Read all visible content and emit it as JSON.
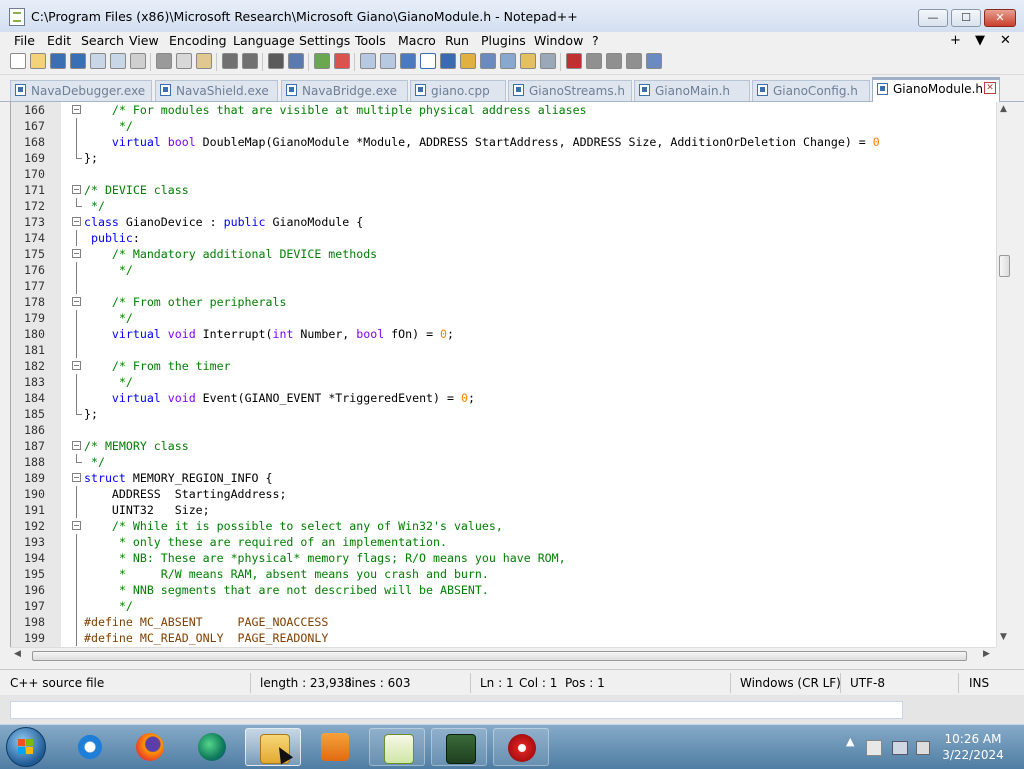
{
  "window": {
    "title": "C:\\Program Files (x86)\\Microsoft Research\\Microsoft Giano\\GianoModule.h - Notepad++",
    "minimize": "—",
    "maximize": "☐",
    "close": "✕"
  },
  "menu": {
    "items": [
      "File",
      "Edit",
      "Search",
      "View",
      "Encoding",
      "Language",
      "Settings",
      "Tools",
      "Macro",
      "Run",
      "Plugins",
      "Window",
      "?"
    ],
    "right": [
      "+",
      "▼",
      "✕"
    ]
  },
  "toolbar": {
    "buttons": [
      "new-file-icon",
      "open-file-icon",
      "save-icon",
      "save-all-icon",
      "close-icon",
      "close-all-icon",
      "print-icon",
      "cut-icon",
      "copy-icon",
      "paste-icon",
      "undo-icon",
      "redo-icon",
      "find-icon",
      "replace-icon",
      "zoom-in-icon",
      "zoom-out-icon",
      "sync-v-icon",
      "sync-h-icon",
      "word-wrap-icon",
      "show-all-chars-icon",
      "indent-guide-icon",
      "user-lang-icon",
      "doc-map-icon",
      "function-list-icon",
      "folder-workspace-icon",
      "monitor-icon",
      "record-macro-icon",
      "stop-macro-icon",
      "play-macro-icon",
      "run-macro-multiple-icon",
      "save-macro-icon"
    ]
  },
  "tabs": [
    {
      "label": "NavaDebugger.exe",
      "active": false
    },
    {
      "label": "NavaShield.exe",
      "active": false
    },
    {
      "label": "NavaBridge.exe",
      "active": false
    },
    {
      "label": "giano.cpp",
      "active": false
    },
    {
      "label": "GianoStreams.h",
      "active": false
    },
    {
      "label": "GianoMain.h",
      "active": false
    },
    {
      "label": "GianoConfig.h",
      "active": false
    },
    {
      "label": "GianoModule.h",
      "active": true
    }
  ],
  "editor": {
    "lines": [
      {
        "n": "166",
        "fold": "box",
        "parts": [
          [
            "comment",
            "    /* For modules that are visible at multiple physical address aliases"
          ]
        ]
      },
      {
        "n": "167",
        "fold": "line",
        "parts": [
          [
            "comment",
            "     */"
          ]
        ]
      },
      {
        "n": "168",
        "fold": "line",
        "parts": [
          [
            "plain",
            "    "
          ],
          [
            "kw",
            "virtual"
          ],
          [
            "plain",
            " "
          ],
          [
            "type",
            "bool"
          ],
          [
            "plain",
            " DoubleMap(GianoModule *Module, ADDRESS StartAddress, ADDRESS Size, AdditionOrDeletion Change) = "
          ],
          [
            "num",
            "0"
          ]
        ]
      },
      {
        "n": "169",
        "fold": "end",
        "parts": [
          [
            "plain",
            "};"
          ]
        ]
      },
      {
        "n": "170",
        "fold": "",
        "parts": [
          [
            "plain",
            ""
          ]
        ]
      },
      {
        "n": "171",
        "fold": "box",
        "parts": [
          [
            "comment",
            "/* DEVICE class"
          ]
        ]
      },
      {
        "n": "172",
        "fold": "end",
        "parts": [
          [
            "comment",
            " */"
          ]
        ]
      },
      {
        "n": "173",
        "fold": "box",
        "parts": [
          [
            "kw",
            "class"
          ],
          [
            "plain",
            " GianoDevice : "
          ],
          [
            "kw",
            "public"
          ],
          [
            "plain",
            " GianoModule {"
          ]
        ]
      },
      {
        "n": "174",
        "fold": "line",
        "parts": [
          [
            "kw",
            " public"
          ],
          [
            "plain",
            ":"
          ]
        ]
      },
      {
        "n": "175",
        "fold": "box",
        "parts": [
          [
            "comment",
            "    /* Mandatory additional DEVICE methods"
          ]
        ]
      },
      {
        "n": "176",
        "fold": "line",
        "parts": [
          [
            "comment",
            "     */"
          ]
        ]
      },
      {
        "n": "177",
        "fold": "line",
        "parts": [
          [
            "plain",
            ""
          ]
        ]
      },
      {
        "n": "178",
        "fold": "box",
        "parts": [
          [
            "comment",
            "    /* From other peripherals"
          ]
        ]
      },
      {
        "n": "179",
        "fold": "line",
        "parts": [
          [
            "comment",
            "     */"
          ]
        ]
      },
      {
        "n": "180",
        "fold": "line",
        "parts": [
          [
            "plain",
            "    "
          ],
          [
            "kw",
            "virtual"
          ],
          [
            "plain",
            " "
          ],
          [
            "type",
            "void"
          ],
          [
            "plain",
            " Interrupt("
          ],
          [
            "type",
            "int"
          ],
          [
            "plain",
            " Number, "
          ],
          [
            "type",
            "bool"
          ],
          [
            "plain",
            " fOn) = "
          ],
          [
            "num",
            "0"
          ],
          [
            "plain",
            ";"
          ]
        ]
      },
      {
        "n": "181",
        "fold": "line",
        "parts": [
          [
            "plain",
            ""
          ]
        ]
      },
      {
        "n": "182",
        "fold": "box",
        "parts": [
          [
            "comment",
            "    /* From the timer"
          ]
        ]
      },
      {
        "n": "183",
        "fold": "line",
        "parts": [
          [
            "comment",
            "     */"
          ]
        ]
      },
      {
        "n": "184",
        "fold": "line",
        "parts": [
          [
            "plain",
            "    "
          ],
          [
            "kw",
            "virtual"
          ],
          [
            "plain",
            " "
          ],
          [
            "type",
            "void"
          ],
          [
            "plain",
            " Event(GIANO_EVENT *TriggeredEvent) = "
          ],
          [
            "num",
            "0"
          ],
          [
            "plain",
            ";"
          ]
        ]
      },
      {
        "n": "185",
        "fold": "end",
        "parts": [
          [
            "plain",
            "};"
          ]
        ]
      },
      {
        "n": "186",
        "fold": "",
        "parts": [
          [
            "plain",
            ""
          ]
        ]
      },
      {
        "n": "187",
        "fold": "box",
        "parts": [
          [
            "comment",
            "/* MEMORY class"
          ]
        ]
      },
      {
        "n": "188",
        "fold": "end",
        "parts": [
          [
            "comment",
            " */"
          ]
        ]
      },
      {
        "n": "189",
        "fold": "box",
        "parts": [
          [
            "kw",
            "struct"
          ],
          [
            "plain",
            " MEMORY_REGION_INFO {"
          ]
        ]
      },
      {
        "n": "190",
        "fold": "line",
        "parts": [
          [
            "plain",
            "    ADDRESS  StartingAddress;"
          ]
        ]
      },
      {
        "n": "191",
        "fold": "line",
        "parts": [
          [
            "plain",
            "    UINT32   Size;"
          ]
        ]
      },
      {
        "n": "192",
        "fold": "box",
        "parts": [
          [
            "comment",
            "    /* While it is possible to select any of Win32's values,"
          ]
        ]
      },
      {
        "n": "193",
        "fold": "line",
        "parts": [
          [
            "comment",
            "     * only these are required of an implementation."
          ]
        ]
      },
      {
        "n": "194",
        "fold": "line",
        "parts": [
          [
            "comment",
            "     * NB: These are *physical* memory flags; R/O means you have ROM,"
          ]
        ]
      },
      {
        "n": "195",
        "fold": "line",
        "parts": [
          [
            "comment",
            "     *     R/W means RAM, absent means you crash and burn."
          ]
        ]
      },
      {
        "n": "196",
        "fold": "line",
        "parts": [
          [
            "comment",
            "     * NNB segments that are not described will be ABSENT."
          ]
        ]
      },
      {
        "n": "197",
        "fold": "line",
        "parts": [
          [
            "comment",
            "     */"
          ]
        ]
      },
      {
        "n": "198",
        "fold": "line",
        "parts": [
          [
            "pp",
            "#define MC_ABSENT     PAGE_NOACCESS"
          ]
        ]
      },
      {
        "n": "199",
        "fold": "line",
        "parts": [
          [
            "pp",
            "#define MC_READ_ONLY  PAGE_READONLY"
          ]
        ]
      }
    ]
  },
  "status": {
    "filetype": "C++ source file",
    "length": "length : 23,938",
    "lines": "lines : 603",
    "ln": "Ln : 1",
    "col": "Col : 1",
    "pos": "Pos : 1",
    "eol": "Windows (CR LF)",
    "encoding": "UTF-8",
    "mode": "INS"
  },
  "taskbar": {
    "apps": [
      "internet-explorer-icon",
      "firefox-icon",
      "edge-icon",
      "file-explorer-icon",
      "media-player-icon",
      "notepad-plus-plus-icon",
      "task-manager-icon",
      "giano-app-icon"
    ],
    "time": "10:26 AM",
    "date": "3/22/2024",
    "tray_chevron": "▲"
  }
}
